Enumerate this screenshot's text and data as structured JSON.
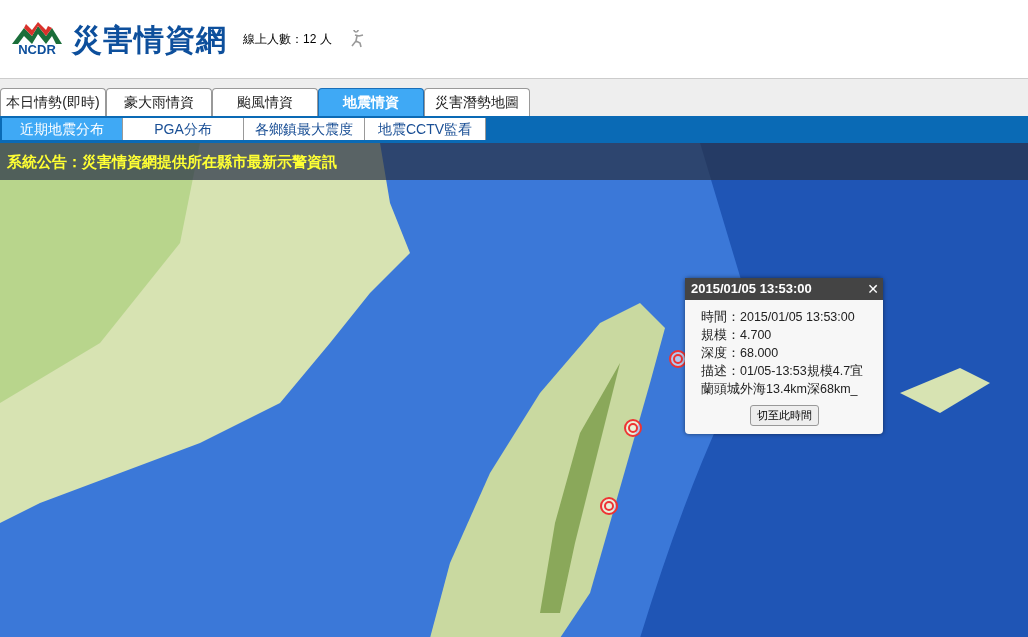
{
  "header": {
    "logo_text": "NCDR",
    "site_title": "災害情資網",
    "online_count": "線上人數：12 人"
  },
  "tabs": [
    {
      "label": "本日情勢(即時)",
      "selected": false
    },
    {
      "label": "豪大雨情資",
      "selected": false
    },
    {
      "label": "颱風情資",
      "selected": false
    },
    {
      "label": "地震情資",
      "selected": true
    },
    {
      "label": "災害潛勢地圖",
      "selected": false
    }
  ],
  "subtabs": [
    {
      "label": "近期地震分布",
      "selected": true
    },
    {
      "label": "PGA分布",
      "selected": false
    },
    {
      "label": "各鄉鎮最大震度",
      "selected": false
    },
    {
      "label": "地震CCTV監看",
      "selected": false
    }
  ],
  "announcement": "系統公告：災害情資網提供所在縣市最新示警資訊",
  "popup": {
    "title": "2015/01/05 13:53:00",
    "close": "✕",
    "lines": [
      "時間：2015/01/05 13:53:00",
      "規模：4.700",
      "深度：68.000",
      "描述：01/05-13:53規模4.7宜蘭頭城外海13.4km深68km_"
    ],
    "button": "切至此時間"
  }
}
